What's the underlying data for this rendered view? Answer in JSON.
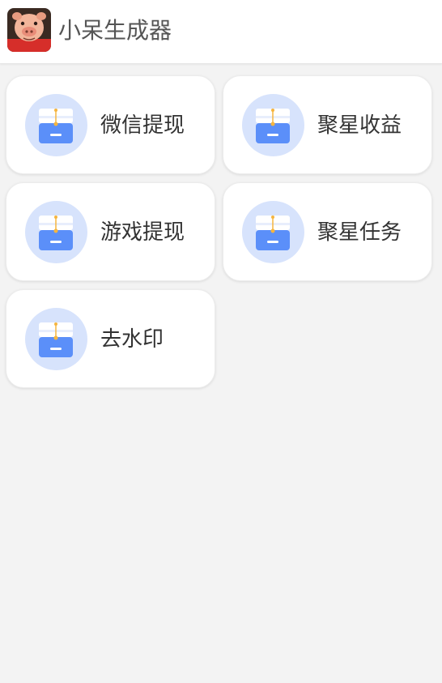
{
  "app": {
    "title": "小呆生成器",
    "icon": "pig-avatar-icon"
  },
  "menu": {
    "items": [
      {
        "label": "微信提现",
        "icon": "inbox-tray-icon"
      },
      {
        "label": "聚星收益",
        "icon": "inbox-tray-icon"
      },
      {
        "label": "游戏提现",
        "icon": "inbox-tray-icon"
      },
      {
        "label": "聚星任务",
        "icon": "inbox-tray-icon"
      },
      {
        "label": "去水印",
        "icon": "inbox-tray-icon"
      }
    ]
  },
  "colors": {
    "background": "#f3f3f3",
    "card": "#ffffff",
    "icon_circle": "#d7e3fc",
    "icon_blue": "#5b8ff9",
    "icon_accent": "#f5b53f"
  }
}
